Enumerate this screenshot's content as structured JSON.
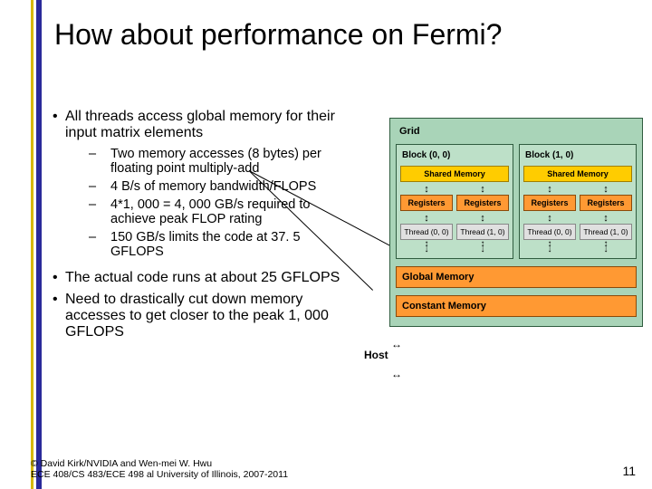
{
  "title": "How about performance on Fermi?",
  "bullets": {
    "b1": "All threads access global memory for their input matrix elements",
    "sub1": "Two memory accesses (8 bytes) per floating point multiply-add",
    "sub2": "4 B/s of memory bandwidth/FLOPS",
    "sub3": "4*1, 000 = 4, 000 GB/s required to achieve peak FLOP rating",
    "sub4": "150 GB/s limits the code at 37. 5 GFLOPS",
    "b2": "The actual code runs at about 25 GFLOPS",
    "b3": "Need to drastically cut down memory accesses to get closer to the peak 1, 000 GFLOPS"
  },
  "diagram": {
    "grid": "Grid",
    "block00": "Block (0, 0)",
    "block10": "Block (1, 0)",
    "shared": "Shared Memory",
    "reg": "Registers",
    "thread00": "Thread (0, 0)",
    "thread10": "Thread (1, 0)",
    "global": "Global Memory",
    "constant": "Constant Memory",
    "host": "Host"
  },
  "copyright": {
    "line1": "© David Kirk/NVIDIA and Wen-mei W. Hwu",
    "line2": "ECE 408/CS 483/ECE 498 al University of Illinois, 2007-2011"
  },
  "page": "11"
}
